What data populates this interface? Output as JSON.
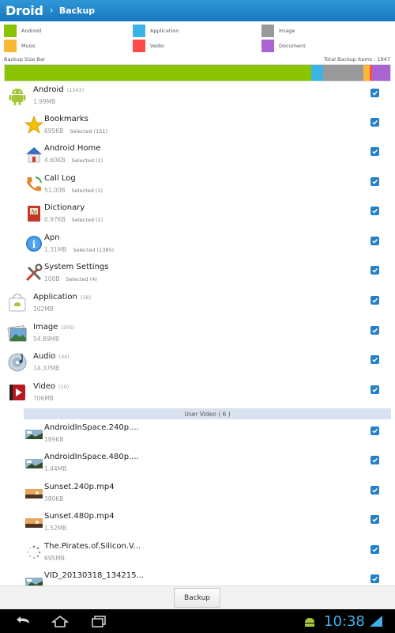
{
  "app": {
    "title": "Droid",
    "page": "Backup"
  },
  "legend": [
    {
      "label": "Android",
      "color": "#8ac400"
    },
    {
      "label": "Application",
      "color": "#38b5e6"
    },
    {
      "label": "Image",
      "color": "#999999"
    },
    {
      "label": "Music",
      "color": "#f9b833"
    },
    {
      "label": "Vedio",
      "color": "#ff4a4a"
    },
    {
      "label": "Document",
      "color": "#a964d2"
    }
  ],
  "backup_bar": {
    "label": "Backup Size Bar",
    "total": "Total Backup Items : 1947",
    "segments": [
      {
        "category": "Android",
        "fraction": 0.795,
        "color": "#8ac400"
      },
      {
        "category": "Application",
        "fraction": 0.03,
        "color": "#38b5e6"
      },
      {
        "category": "Image",
        "fraction": 0.105,
        "color": "#999999"
      },
      {
        "category": "Music",
        "fraction": 0.017,
        "color": "#f9b833"
      },
      {
        "category": "Vedio",
        "fraction": 0.005,
        "color": "#ff4a4a"
      },
      {
        "category": "Document",
        "fraction": 0.048,
        "color": "#a964d2"
      }
    ]
  },
  "rows": [
    {
      "icon": "android-robot-icon",
      "name": "Android",
      "count": "(1543)",
      "size": "1.99MB",
      "selected": "",
      "checked": true
    },
    {
      "icon": "star-icon",
      "name": "Bookmarks",
      "count": "",
      "size": "695KB",
      "selected": "Selected (151)",
      "checked": true
    },
    {
      "icon": "home-icon",
      "name": "Android Home",
      "count": "",
      "size": "4.60KB",
      "selected": "Selected (1)",
      "checked": true
    },
    {
      "icon": "phone-call-icon",
      "name": "Call Log",
      "count": "",
      "size": "51.00B",
      "selected": "Selected (1)",
      "checked": true
    },
    {
      "icon": "dictionary-icon",
      "name": "Dictionary",
      "count": "",
      "size": "0.97KB",
      "selected": "Selected (1)",
      "checked": true
    },
    {
      "icon": "info-icon",
      "name": "Apn",
      "count": "",
      "size": "1.31MB",
      "selected": "Selected (1385)",
      "checked": true
    },
    {
      "icon": "tools-icon",
      "name": "System Settings",
      "count": "",
      "size": "108B",
      "selected": "Selected (4)",
      "checked": true
    },
    {
      "icon": "app-bag-icon",
      "name": "Application",
      "count": "(58)",
      "size": "102MB",
      "selected": "",
      "checked": true
    },
    {
      "icon": "image-icon",
      "name": "Image",
      "count": "(205)",
      "size": "54.89MB",
      "selected": "",
      "checked": true
    },
    {
      "icon": "audio-disc-icon",
      "name": "Audio",
      "count": "(34)",
      "size": "14.37MB",
      "selected": "",
      "checked": true
    },
    {
      "icon": "video-play-icon",
      "name": "Video",
      "count": "(10)",
      "size": "706MB",
      "selected": "",
      "checked": true
    },
    {
      "icon": "video-thumb-icon",
      "name": "AndroidInSpace.240p....",
      "count": "",
      "size": "189KB",
      "selected": "",
      "checked": true
    },
    {
      "icon": "video-thumb-icon",
      "name": "AndroidInSpace.480p....",
      "count": "",
      "size": "1.44MB",
      "selected": "",
      "checked": true
    },
    {
      "icon": "sunset-thumb-icon",
      "name": "Sunset.240p.mp4",
      "count": "",
      "size": "380KB",
      "selected": "",
      "checked": true
    },
    {
      "icon": "sunset-thumb-icon",
      "name": "Sunset.480p.mp4",
      "count": "",
      "size": "1.52MB",
      "selected": "",
      "checked": true
    },
    {
      "icon": "loading-spinner-icon",
      "name": "The.Pirates.of.Silicon.V...",
      "count": "",
      "size": "695MB",
      "selected": "",
      "checked": true
    },
    {
      "icon": "video-thumb-icon",
      "name": "VID_20130318_134215...",
      "count": "",
      "size": "",
      "selected": "",
      "checked": true
    }
  ],
  "subheader": "User Video ( 6 )",
  "action": {
    "backup_label": "Backup"
  },
  "system": {
    "clock": "10:38"
  }
}
